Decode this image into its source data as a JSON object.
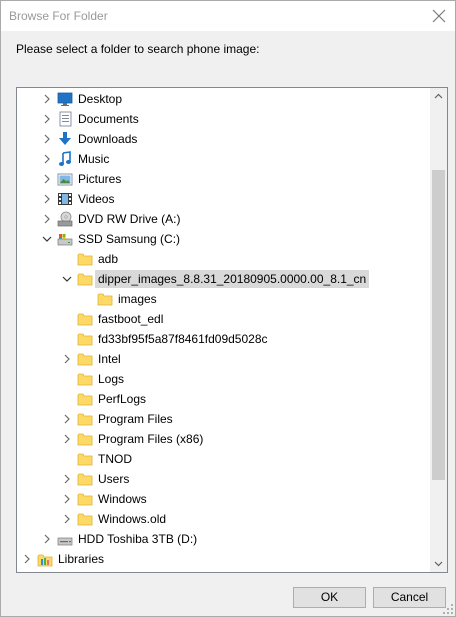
{
  "window": {
    "title": "Browse For Folder",
    "close_icon": "close-icon"
  },
  "prompt": "Please select a folder to search phone image:",
  "tree": {
    "items": [
      {
        "label": "Desktop",
        "level": 1,
        "expander": "collapsed",
        "icon": "desktop-icon"
      },
      {
        "label": "Documents",
        "level": 1,
        "expander": "collapsed",
        "icon": "documents-icon"
      },
      {
        "label": "Downloads",
        "level": 1,
        "expander": "collapsed",
        "icon": "downloads-icon"
      },
      {
        "label": "Music",
        "level": 1,
        "expander": "collapsed",
        "icon": "music-icon"
      },
      {
        "label": "Pictures",
        "level": 1,
        "expander": "collapsed",
        "icon": "pictures-icon"
      },
      {
        "label": "Videos",
        "level": 1,
        "expander": "collapsed",
        "icon": "videos-icon"
      },
      {
        "label": "DVD RW Drive (A:)",
        "level": 1,
        "expander": "collapsed",
        "icon": "dvd-drive-icon"
      },
      {
        "label": "SSD Samsung (C:)",
        "level": 1,
        "expander": "expanded",
        "icon": "drive-icon"
      },
      {
        "label": "adb",
        "level": 2,
        "expander": "none",
        "icon": "folder-icon"
      },
      {
        "label": "dipper_images_8.8.31_20180905.0000.00_8.1_cn",
        "level": 2,
        "expander": "expanded",
        "icon": "folder-icon",
        "selected": true
      },
      {
        "label": "images",
        "level": 3,
        "expander": "none",
        "icon": "folder-icon"
      },
      {
        "label": "fastboot_edl",
        "level": 2,
        "expander": "none",
        "icon": "folder-icon"
      },
      {
        "label": "fd33bf95f5a87f8461fd09d5028c",
        "level": 2,
        "expander": "none",
        "icon": "folder-icon"
      },
      {
        "label": "Intel",
        "level": 2,
        "expander": "collapsed",
        "icon": "folder-icon"
      },
      {
        "label": "Logs",
        "level": 2,
        "expander": "none",
        "icon": "folder-icon"
      },
      {
        "label": "PerfLogs",
        "level": 2,
        "expander": "none",
        "icon": "folder-icon"
      },
      {
        "label": "Program Files",
        "level": 2,
        "expander": "collapsed",
        "icon": "folder-icon"
      },
      {
        "label": "Program Files (x86)",
        "level": 2,
        "expander": "collapsed",
        "icon": "folder-icon"
      },
      {
        "label": "TNOD",
        "level": 2,
        "expander": "none",
        "icon": "folder-icon"
      },
      {
        "label": "Users",
        "level": 2,
        "expander": "collapsed",
        "icon": "folder-icon"
      },
      {
        "label": "Windows",
        "level": 2,
        "expander": "collapsed",
        "icon": "folder-icon"
      },
      {
        "label": "Windows.old",
        "level": 2,
        "expander": "collapsed",
        "icon": "folder-icon"
      },
      {
        "label": "HDD Toshiba 3TB (D:)",
        "level": 1,
        "expander": "collapsed",
        "icon": "hard-drive-icon"
      },
      {
        "label": "Libraries",
        "level": 0,
        "expander": "collapsed",
        "icon": "libraries-icon"
      }
    ]
  },
  "buttons": {
    "ok": "OK",
    "cancel": "Cancel"
  },
  "colors": {
    "selection": "#d9d9d9",
    "folder": "#ffd966",
    "folder_edge": "#dcb23c",
    "accent": "#1e73c8"
  }
}
